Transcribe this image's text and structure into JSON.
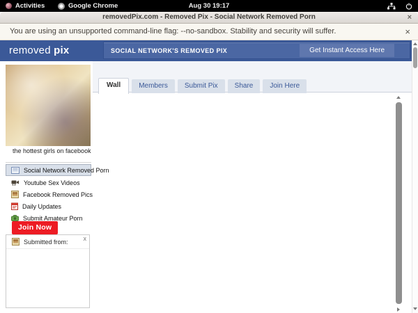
{
  "colors": {
    "facebook_blue": "#3b5998",
    "banner_blue": "#4b67a3",
    "cta_blue": "#5f77ae",
    "tab_inactive_bg": "#d9e0ea",
    "join_red": "#ed1c24",
    "infobar_bg": "#f9f7f1",
    "topbar_bg": "#000000"
  },
  "topbar": {
    "activities_label": "Activities",
    "app_label": "Google Chrome",
    "clock": "Aug 30 19:17"
  },
  "window": {
    "title": "removedPix.com - Removed Pix - Social Network Removed Porn",
    "close_glyph": "×"
  },
  "infobar": {
    "message": "You are using an unsupported command-line flag: --no-sandbox. Stability and security will suffer.",
    "close_glyph": "×"
  },
  "header": {
    "logo_word1": "removed ",
    "logo_word2": "pix",
    "banner": "SOCIAL NETWORK'S REMOVED PIX",
    "cta": "Get Instant Access Here"
  },
  "tabs": [
    {
      "label": "Wall",
      "active": true
    },
    {
      "label": "Members",
      "active": false
    },
    {
      "label": "Submit Pix",
      "active": false
    },
    {
      "label": "Share",
      "active": false
    },
    {
      "label": "Join Here",
      "active": false
    }
  ],
  "sidebar": {
    "caption": "the hottest girls on facebook",
    "menu": [
      {
        "label": "Social Network Removed Porn",
        "icon": "wall-feed-icon"
      },
      {
        "label": "Youtube Sex Videos",
        "icon": "video-camera-icon"
      },
      {
        "label": "Facebook Removed Pics",
        "icon": "photo-icon"
      },
      {
        "label": "Daily Updates",
        "icon": "calendar-icon"
      },
      {
        "label": "Submit Amateur Porn",
        "icon": "camera-upload-icon"
      }
    ],
    "join_button_label": "Join Now",
    "submitted_label": "Submitted from:",
    "submitted_close_glyph": "x"
  }
}
